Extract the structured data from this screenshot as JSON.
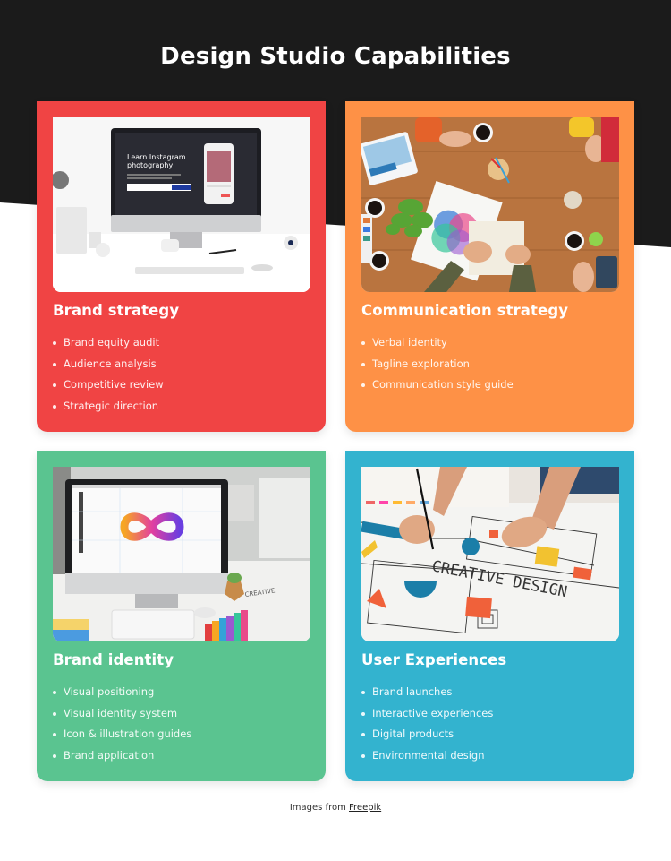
{
  "header": {
    "title": "Design Studio Capabilities"
  },
  "colors": {
    "background_dark": "#1b1b1b",
    "card_red": "#f04444",
    "card_orange": "#fe9146",
    "card_green": "#5ac490",
    "card_blue": "#33b3cf"
  },
  "cards": [
    {
      "title": "Brand strategy",
      "color": "#f04444",
      "image": "desktop-instagram-photography-mockup",
      "image_text": {
        "heading_line1": "Learn Instagram",
        "heading_line2": "photography"
      },
      "items": [
        "Brand equity audit",
        "Audience analysis",
        "Competitive review",
        "Strategic direction"
      ]
    },
    {
      "title": "Communication strategy",
      "color": "#fe9146",
      "image": "team-meeting-wooden-table",
      "items": [
        "Verbal identity",
        "Tagline exploration",
        "Communication style guide"
      ]
    },
    {
      "title": "Brand identity",
      "color": "#5ac490",
      "image": "infinity-logo-on-monitor",
      "items": [
        "Visual positioning",
        "Visual identity system",
        "Icon & illustration guides",
        "Brand application"
      ]
    },
    {
      "title": "User Experiences",
      "color": "#33b3cf",
      "image": "creative-design-sketch",
      "image_text": {
        "caption": "CREATIVE DESIGN"
      },
      "items": [
        "Brand launches",
        "Interactive experiences",
        "Digital products",
        "Environmental design"
      ]
    }
  ],
  "footer": {
    "credits_prefix": "Images from",
    "credits_link": "Freepik"
  }
}
